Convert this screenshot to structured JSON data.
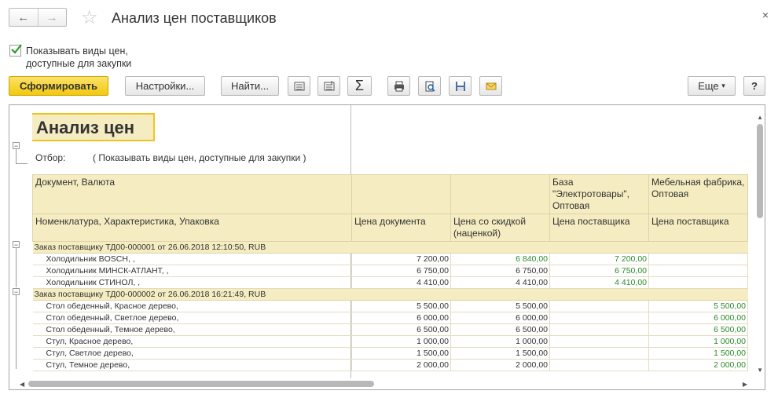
{
  "window": {
    "title": "Анализ цен поставщиков",
    "back_icon": "←",
    "forward_icon": "→",
    "star_icon": "☆",
    "close_icon": "×"
  },
  "option": {
    "checked": true,
    "label": "Показывать виды цен, доступные для закупки"
  },
  "toolbar": {
    "generate": "Сформировать",
    "settings": "Настройки...",
    "find": "Найти...",
    "sum": "Σ",
    "more": "Еще",
    "more_arrow": "▾",
    "help": "?"
  },
  "report": {
    "title": "Анализ цен",
    "filter_label": "Отбор:",
    "filter_value": "( Показывать виды цен, доступные для закупки )",
    "header1": [
      "Документ, Валюта",
      "",
      "",
      "База \"Электротовары\", Оптовая",
      "Мебельная фабрика, Оптовая"
    ],
    "header2": [
      "Номенклатура, Характеристика, Упаковка",
      "Цена документа",
      "Цена со скидкой (наценкой)",
      "Цена поставщика",
      "Цена поставщика"
    ],
    "groups": [
      {
        "title": "Заказ поставщику ТД00-000001 от 26.06.2018 12:10:50, RUB",
        "rows": [
          [
            "Холодильник BOSCH, ,",
            "7 200,00",
            "6 840,00",
            "7 200,00",
            ""
          ],
          [
            "Холодильник МИНСК-АТЛАНТ, ,",
            "6 750,00",
            "6 750,00",
            "6 750,00",
            ""
          ],
          [
            "Холодильник СТИНОЛ, ,",
            "4 410,00",
            "4 410,00",
            "4 410,00",
            ""
          ]
        ]
      },
      {
        "title": "Заказ поставщику ТД00-000002 от 26.06.2018 16:21:49, RUB",
        "rows": [
          [
            "Стол обеденный, Красное дерево,",
            "5 500,00",
            "5 500,00",
            "",
            "5 500,00"
          ],
          [
            "Стол обеденный, Светлое дерево,",
            "6 000,00",
            "6 000,00",
            "",
            "6 000,00"
          ],
          [
            "Стол обеденный, Темное дерево,",
            "6 500,00",
            "6 500,00",
            "",
            "6 500,00"
          ],
          [
            "Стул, Красное дерево,",
            "1 000,00",
            "1 000,00",
            "",
            "1 000,00"
          ],
          [
            "Стул, Светлое дерево,",
            "1 500,00",
            "1 500,00",
            "",
            "1 500,00"
          ],
          [
            "Стул, Темное дерево,",
            "2 000,00",
            "2 000,00",
            "",
            "2 000,00"
          ]
        ]
      }
    ],
    "highlight_color": "#2a8a2a",
    "header_bg": "#f5ecc1"
  }
}
